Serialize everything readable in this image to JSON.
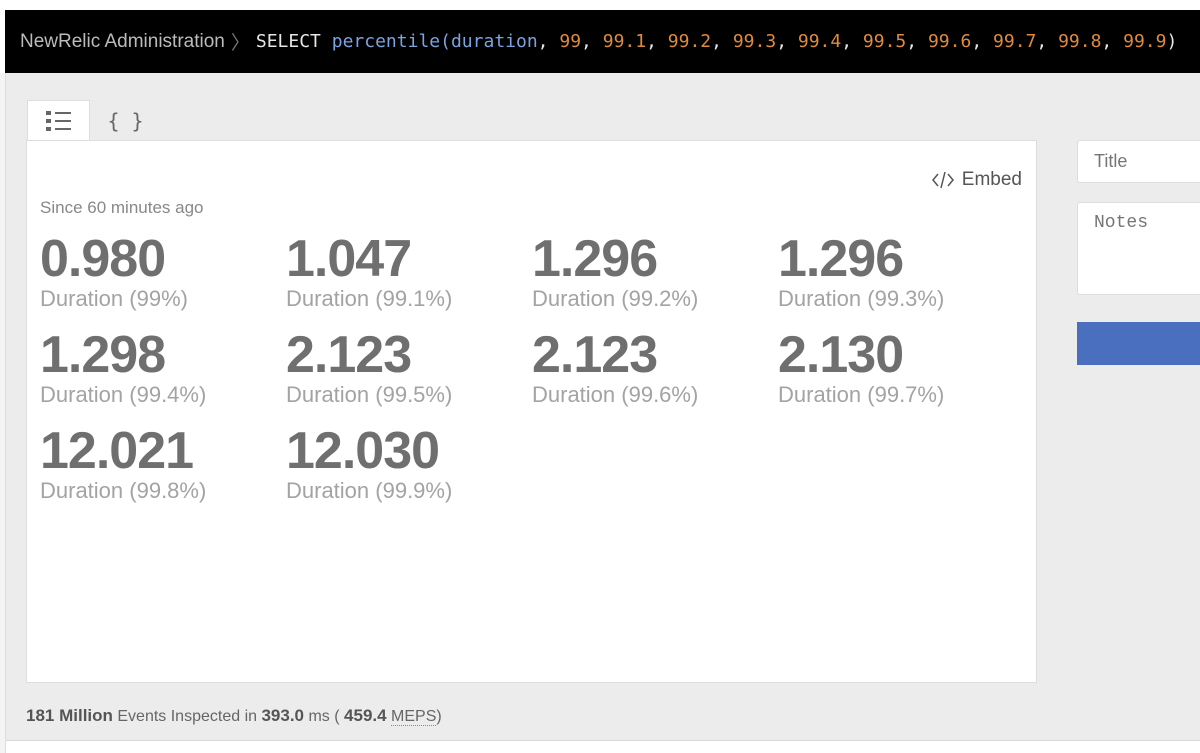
{
  "header": {
    "breadcrumb": "NewRelic Administration",
    "query": {
      "select": "SELECT",
      "fn": "percentile(",
      "field": "duration",
      "args": [
        "99",
        "99.1",
        "99.2",
        "99.3",
        "99.4",
        "99.5",
        "99.6",
        "99.7",
        "99.8",
        "99.9"
      ],
      "close": ")"
    }
  },
  "tabs": [
    {
      "name": "list",
      "icon": "list-icon"
    },
    {
      "name": "json",
      "label": "{ }"
    }
  ],
  "card": {
    "embed_label": "Embed",
    "since": "Since 60 minutes ago",
    "metrics": [
      {
        "value": "0.980",
        "label": "Duration (99%)"
      },
      {
        "value": "1.047",
        "label": "Duration (99.1%)"
      },
      {
        "value": "1.296",
        "label": "Duration (99.2%)"
      },
      {
        "value": "1.296",
        "label": "Duration (99.3%)"
      },
      {
        "value": "1.298",
        "label": "Duration (99.4%)"
      },
      {
        "value": "2.123",
        "label": "Duration (99.5%)"
      },
      {
        "value": "2.123",
        "label": "Duration (99.6%)"
      },
      {
        "value": "2.130",
        "label": "Duration (99.7%)"
      },
      {
        "value": "12.021",
        "label": "Duration (99.8%)"
      },
      {
        "value": "12.030",
        "label": "Duration (99.9%)"
      }
    ]
  },
  "footer": {
    "events": "181 Million",
    "events_text": "Events Inspected in",
    "time": "393.0",
    "time_unit": "ms (",
    "meps": "459.4",
    "meps_label": "MEPS",
    "close": ")"
  },
  "side": {
    "title_placeholder": "Title",
    "notes_placeholder": "Notes",
    "button_color": "#4a6fbf"
  }
}
